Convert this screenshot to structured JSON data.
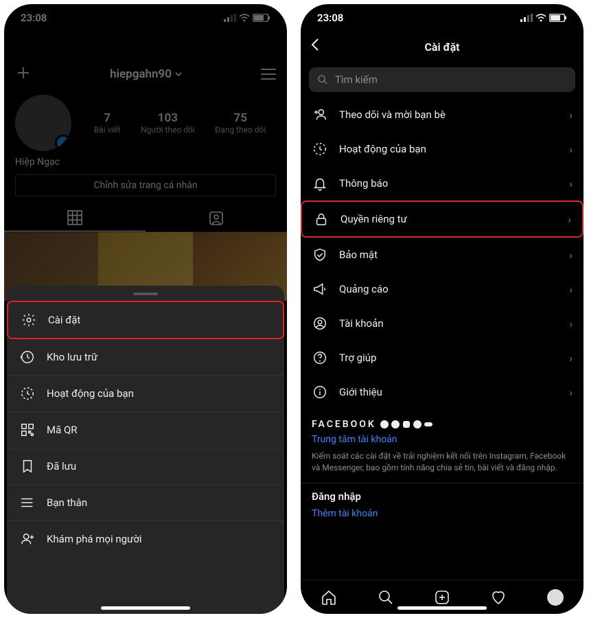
{
  "status": {
    "time": "23:08"
  },
  "phone1": {
    "username": "hiepgahn90",
    "stats": [
      {
        "num": "7",
        "lbl": "Bài viết"
      },
      {
        "num": "103",
        "lbl": "Người theo dõi"
      },
      {
        "num": "75",
        "lbl": "Đang theo dõi"
      }
    ],
    "display_name": "Hiệp Ngạc",
    "edit_label": "Chỉnh sửa trang cá nhân",
    "sheet": [
      {
        "label": "Cài đặt",
        "icon": "gear-icon",
        "highlighted": true
      },
      {
        "label": "Kho lưu trữ",
        "icon": "archive-icon"
      },
      {
        "label": "Hoạt động của bạn",
        "icon": "activity-icon"
      },
      {
        "label": "Mã QR",
        "icon": "qr-icon"
      },
      {
        "label": "Đã lưu",
        "icon": "bookmark-icon"
      },
      {
        "label": "Bạn thân",
        "icon": "close-friends-icon"
      },
      {
        "label": "Khám phá mọi người",
        "icon": "discover-people-icon"
      }
    ]
  },
  "phone2": {
    "title": "Cài đặt",
    "search_placeholder": "Tìm kiếm",
    "items": [
      {
        "label": "Theo dõi và mời bạn bè",
        "icon": "add-friend-icon"
      },
      {
        "label": "Hoạt động của bạn",
        "icon": "activity-icon"
      },
      {
        "label": "Thông báo",
        "icon": "bell-icon"
      },
      {
        "label": "Quyền riêng tư",
        "icon": "lock-icon",
        "highlighted": true
      },
      {
        "label": "Bảo mật",
        "icon": "shield-icon"
      },
      {
        "label": "Quảng cáo",
        "icon": "megaphone-icon"
      },
      {
        "label": "Tài khoản",
        "icon": "account-icon"
      },
      {
        "label": "Trợ giúp",
        "icon": "help-icon"
      },
      {
        "label": "Giới thiệu",
        "icon": "info-icon"
      }
    ],
    "facebook_label": "FACEBOOK",
    "accounts_center": "Trung tâm tài khoản",
    "accounts_desc": "Kiểm soát các cài đặt về trải nghiệm kết nối trên Instagram, Facebook và Messenger, bao gồm tính năng chia sẻ tin, bài viết và đăng nhập.",
    "login_section": "Đăng nhập",
    "add_account": "Thêm tài khoản"
  }
}
